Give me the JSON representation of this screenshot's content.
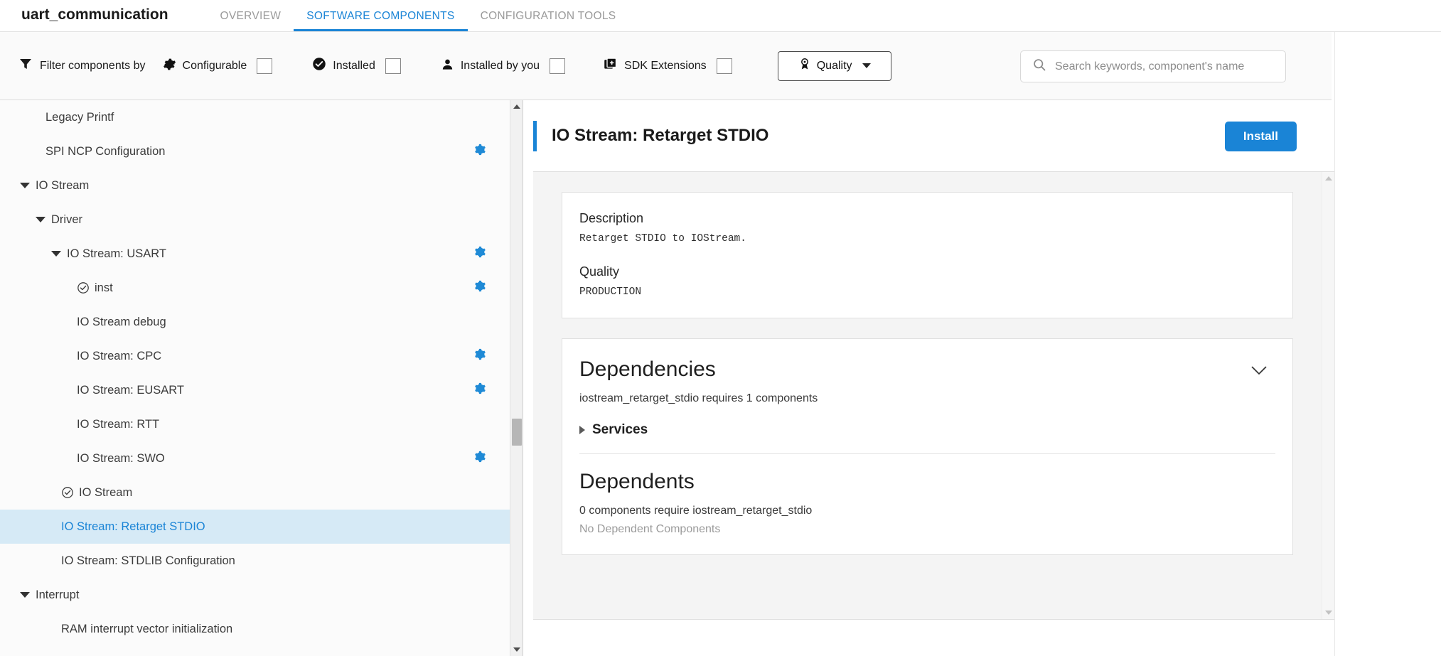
{
  "header": {
    "project_title": "uart_communication",
    "tabs": [
      {
        "label": "OVERVIEW",
        "active": false
      },
      {
        "label": "SOFTWARE COMPONENTS",
        "active": true
      },
      {
        "label": "CONFIGURATION TOOLS",
        "active": false
      }
    ]
  },
  "toolbar": {
    "filter_label": "Filter components by",
    "filters": [
      {
        "label": "Configurable",
        "icon": "gear-icon",
        "checked": false
      },
      {
        "label": "Installed",
        "icon": "check-circle-icon",
        "checked": false
      },
      {
        "label": "Installed by you",
        "icon": "person-icon",
        "checked": false
      },
      {
        "label": "SDK Extensions",
        "icon": "sdk-extension-icon",
        "checked": false
      }
    ],
    "quality_button": {
      "label": "Quality",
      "icon": "award-ribbon-icon"
    },
    "search": {
      "value": "",
      "placeholder": "Search keywords, component's name"
    }
  },
  "sidebar": {
    "items": [
      {
        "label": "Legacy Printf",
        "indent": 1,
        "arrow": "none",
        "status": "none",
        "gear": false,
        "selected": false
      },
      {
        "label": "SPI NCP Configuration",
        "indent": 1,
        "arrow": "none",
        "status": "none",
        "gear": true,
        "selected": false
      },
      {
        "label": "IO Stream",
        "indent": 0,
        "arrow": "down",
        "status": "none",
        "gear": false,
        "selected": false
      },
      {
        "label": "Driver",
        "indent": 1,
        "arrow": "down",
        "status": "none",
        "gear": false,
        "selected": false
      },
      {
        "label": "IO Stream: USART",
        "indent": 2,
        "arrow": "down",
        "status": "none",
        "gear": true,
        "selected": false
      },
      {
        "label": "inst",
        "indent": 3,
        "arrow": "none",
        "status": "check",
        "gear": true,
        "selected": false
      },
      {
        "label": "IO Stream debug",
        "indent": 3,
        "arrow": "none",
        "status": "none",
        "gear": false,
        "selected": false
      },
      {
        "label": "IO Stream: CPC",
        "indent": 3,
        "arrow": "none",
        "status": "none",
        "gear": true,
        "selected": false
      },
      {
        "label": "IO Stream: EUSART",
        "indent": 3,
        "arrow": "none",
        "status": "none",
        "gear": true,
        "selected": false
      },
      {
        "label": "IO Stream: RTT",
        "indent": 3,
        "arrow": "none",
        "status": "none",
        "gear": false,
        "selected": false
      },
      {
        "label": "IO Stream: SWO",
        "indent": 3,
        "arrow": "none",
        "status": "none",
        "gear": true,
        "selected": false
      },
      {
        "label": "IO Stream",
        "indent": 2,
        "arrow": "none",
        "status": "check",
        "gear": false,
        "selected": false
      },
      {
        "label": "IO Stream: Retarget STDIO",
        "indent": 2,
        "arrow": "none",
        "status": "none",
        "gear": false,
        "selected": true
      },
      {
        "label": "IO Stream: STDLIB Configuration",
        "indent": 2,
        "arrow": "none",
        "status": "none",
        "gear": false,
        "selected": false
      },
      {
        "label": "Interrupt",
        "indent": 0,
        "arrow": "down",
        "status": "none",
        "gear": false,
        "selected": false
      },
      {
        "label": "RAM interrupt vector initialization",
        "indent": 2,
        "arrow": "none",
        "status": "none",
        "gear": false,
        "selected": false
      }
    ]
  },
  "detail": {
    "title": "IO Stream: Retarget STDIO",
    "install_label": "Install",
    "description_heading": "Description",
    "description_text": "Retarget STDIO to IOStream.",
    "quality_heading": "Quality",
    "quality_value": "PRODUCTION",
    "dependencies_heading": "Dependencies",
    "dependencies_summary": "iostream_retarget_stdio requires 1 components",
    "services_label": "Services",
    "dependents_heading": "Dependents",
    "dependents_summary": "0 components require iostream_retarget_stdio",
    "dependents_empty": "No Dependent Components"
  },
  "colors": {
    "accent": "#1a84d6",
    "gear": "#1f8ad6",
    "selection_bg": "#d6eaf6",
    "toolbar_bg": "#fafafa",
    "panel_bg": "#f4f4f4"
  }
}
